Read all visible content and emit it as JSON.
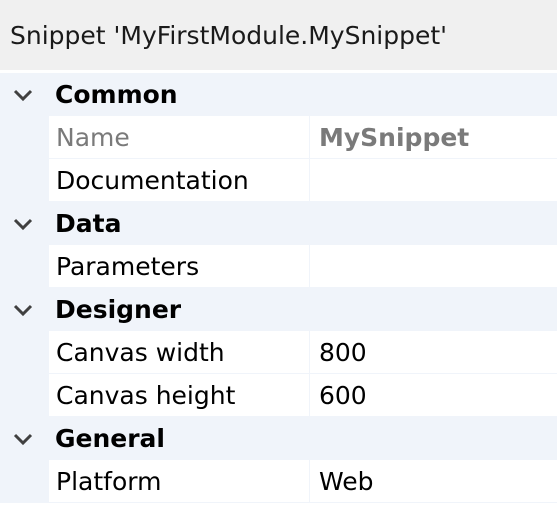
{
  "title": "Snippet 'MyFirstModule.MySnippet'",
  "categories": [
    {
      "label": "Common",
      "properties": [
        {
          "name": "Name",
          "value": "MySnippet"
        },
        {
          "name": "Documentation",
          "value": ""
        }
      ]
    },
    {
      "label": "Data",
      "properties": [
        {
          "name": "Parameters",
          "value": ""
        }
      ]
    },
    {
      "label": "Designer",
      "properties": [
        {
          "name": "Canvas width",
          "value": "800"
        },
        {
          "name": "Canvas height",
          "value": "600"
        }
      ]
    },
    {
      "label": "General",
      "properties": [
        {
          "name": "Platform",
          "value": "Web"
        }
      ]
    }
  ],
  "icons": {
    "expand": "chevron-down-icon"
  },
  "colors": {
    "title_bg": "#f0f0f0",
    "category_bg": "#f0f4fa",
    "readonly_text": "#7a7a7a"
  }
}
